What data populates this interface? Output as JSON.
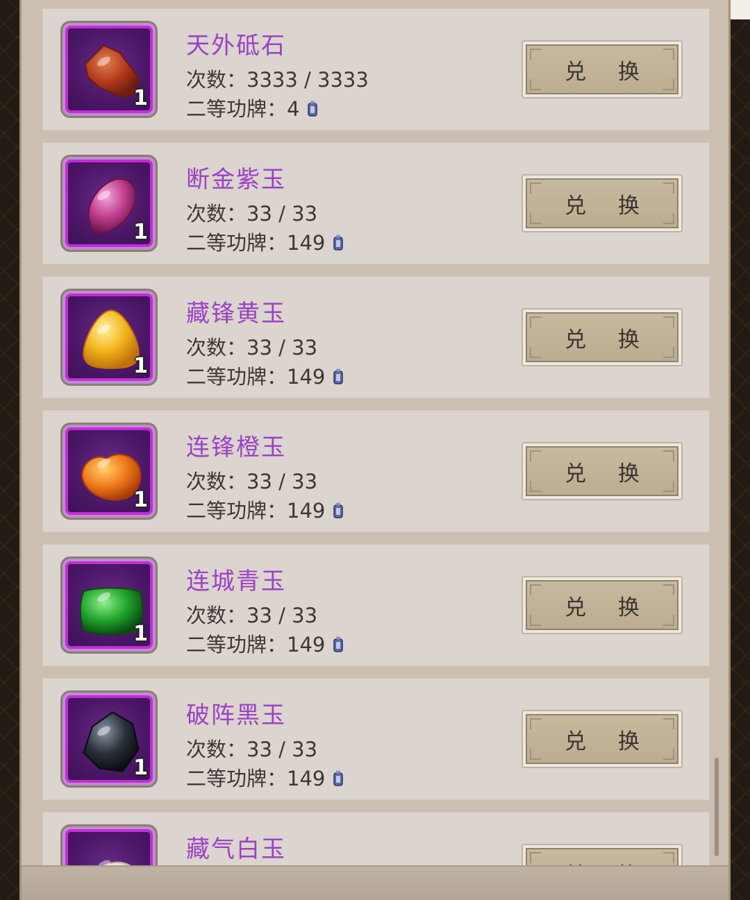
{
  "exchange_list": {
    "count_label": "次数：",
    "cost_label": "二等功牌：",
    "button_label": "兑 换",
    "items": [
      {
        "name": "天外砥石",
        "count": "3333 / 3333",
        "cost": "4",
        "quantity": "1",
        "gem": "whetstone",
        "gem_colors": [
          "#e08050",
          "#b23a1c",
          "#6e1b10"
        ]
      },
      {
        "name": "断金紫玉",
        "count": "33 / 33",
        "cost": "149",
        "quantity": "1",
        "gem": "purple-jade",
        "gem_colors": [
          "#f2a8d8",
          "#c2408f",
          "#6a1448"
        ]
      },
      {
        "name": "藏锋黄玉",
        "count": "33 / 33",
        "cost": "149",
        "quantity": "1",
        "gem": "yellow-jade",
        "gem_colors": [
          "#fff0a0",
          "#f2b418",
          "#c0700a"
        ]
      },
      {
        "name": "连锋橙玉",
        "count": "33 / 33",
        "cost": "149",
        "quantity": "1",
        "gem": "orange-jade",
        "gem_colors": [
          "#ffd06a",
          "#f07a1a",
          "#a83a08"
        ]
      },
      {
        "name": "连城青玉",
        "count": "33 / 33",
        "cost": "149",
        "quantity": "1",
        "gem": "green-jade",
        "gem_colors": [
          "#8ff08a",
          "#1fa22a",
          "#0a4a12"
        ]
      },
      {
        "name": "破阵黑玉",
        "count": "33 / 33",
        "cost": "149",
        "quantity": "1",
        "gem": "black-jade",
        "gem_colors": [
          "#8a96a6",
          "#2a2f38",
          "#0a0c10"
        ]
      },
      {
        "name": "藏气白玉",
        "count": "",
        "cost": "",
        "quantity": "",
        "gem": "white-jade",
        "gem_colors": [
          "#ffffff",
          "#e8e2d8",
          "#b8ae9e"
        ]
      }
    ]
  },
  "colors": {
    "item_name": "#9b42c4",
    "icon_border": "#c62bd6",
    "panel": "#dcd4cf"
  }
}
